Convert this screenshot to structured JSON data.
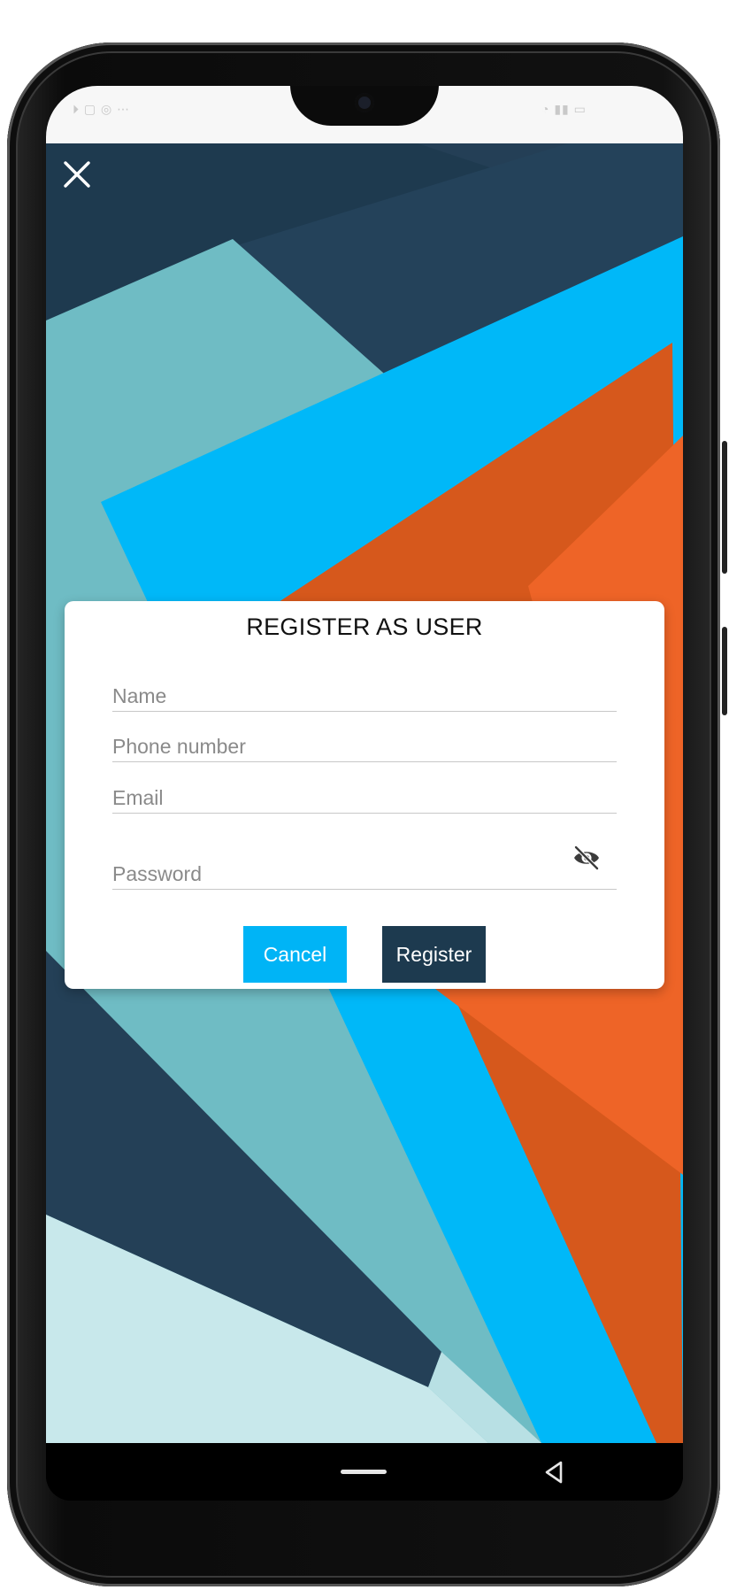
{
  "dialog": {
    "title": "REGISTER AS USER",
    "fields": {
      "name": {
        "placeholder": "Name",
        "value": ""
      },
      "phone": {
        "placeholder": "Phone number",
        "value": ""
      },
      "email": {
        "placeholder": "Email",
        "value": ""
      },
      "password": {
        "placeholder": "Password",
        "value": ""
      }
    },
    "cancel_label": "Cancel",
    "register_label": "Register"
  },
  "icons": {
    "close": "close-icon",
    "password_toggle": "eye-off-icon",
    "home": "home-pill-icon",
    "back": "back-triangle-icon"
  },
  "colors": {
    "accent_blue": "#00b4f6",
    "navy": "#1d3a4f",
    "teal": "#6fbcc4",
    "orange": "#d6581c",
    "light_orange": "#ee6427",
    "pale_teal": "#c8e8eb"
  }
}
